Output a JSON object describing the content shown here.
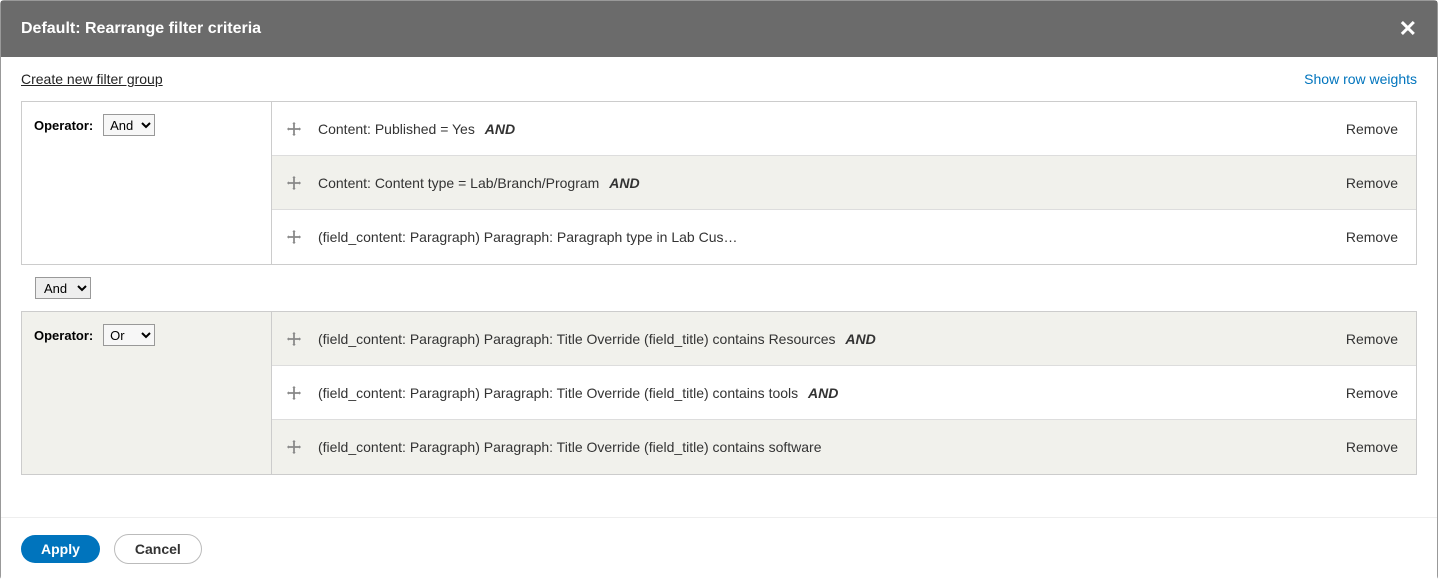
{
  "dialog": {
    "title": "Default: Rearrange filter criteria"
  },
  "links": {
    "create_group": "Create new filter group",
    "show_weights": "Show row weights"
  },
  "labels": {
    "operator": "Operator:",
    "remove": "Remove",
    "apply": "Apply",
    "cancel": "Cancel"
  },
  "group1": {
    "operator": "And",
    "rows": [
      {
        "text": "Content: Published = Yes",
        "suffix": "AND"
      },
      {
        "text": "Content: Content type = Lab/Branch/Program",
        "suffix": "AND"
      },
      {
        "text": "(field_content: Paragraph) Paragraph: Paragraph type in Lab Cus…",
        "suffix": ""
      }
    ]
  },
  "between_operator": "And",
  "group2": {
    "operator": "Or",
    "rows": [
      {
        "text": "(field_content: Paragraph) Paragraph: Title Override (field_title) contains Resources",
        "suffix": "AND"
      },
      {
        "text": "(field_content: Paragraph) Paragraph: Title Override (field_title) contains tools",
        "suffix": "AND"
      },
      {
        "text": "(field_content: Paragraph) Paragraph: Title Override (field_title) contains software",
        "suffix": ""
      }
    ]
  }
}
